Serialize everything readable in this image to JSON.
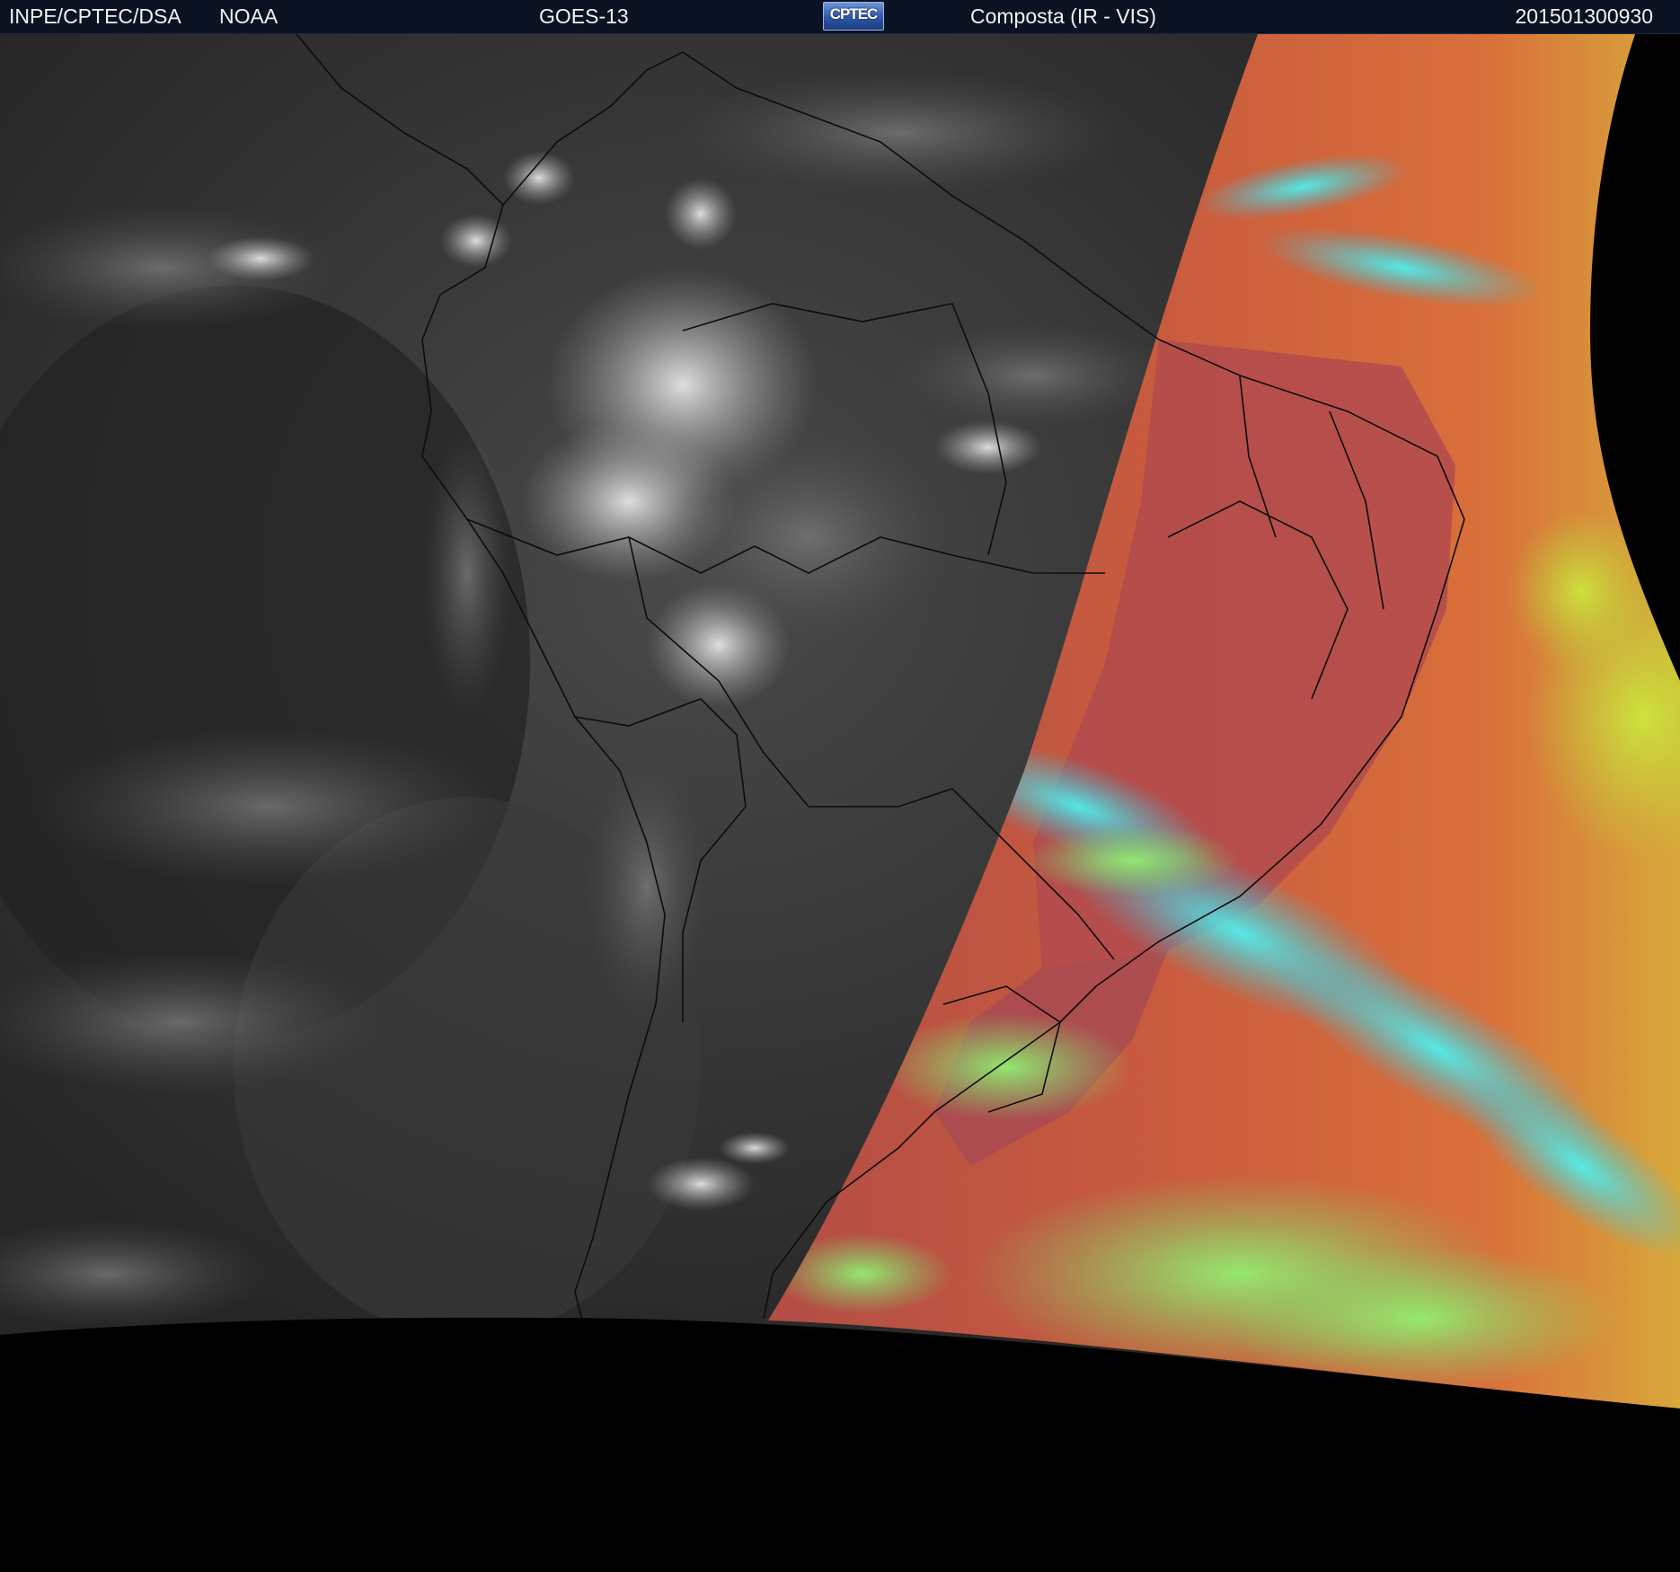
{
  "header": {
    "agency": "INPE/CPTEC/DSA",
    "partner": "NOAA",
    "satellite": "GOES-13",
    "logo_text": "CPTEC",
    "product": "Composta (IR - VIS)",
    "timestamp": "201501300930"
  },
  "colors": {
    "header_background": "#0b1322",
    "header_text": "#f2f2f2",
    "ir_night_side": "#303030",
    "vis_day_side_land": "#b24f49",
    "vis_day_side_ocean": "#d8683b",
    "clouds_cyan": "#3fe5e6",
    "clouds_green": "#86e86b",
    "outside_disk": "#000000",
    "borders": "#0c0c0c"
  },
  "icons": {
    "logo": "cptec-logo-icon"
  }
}
